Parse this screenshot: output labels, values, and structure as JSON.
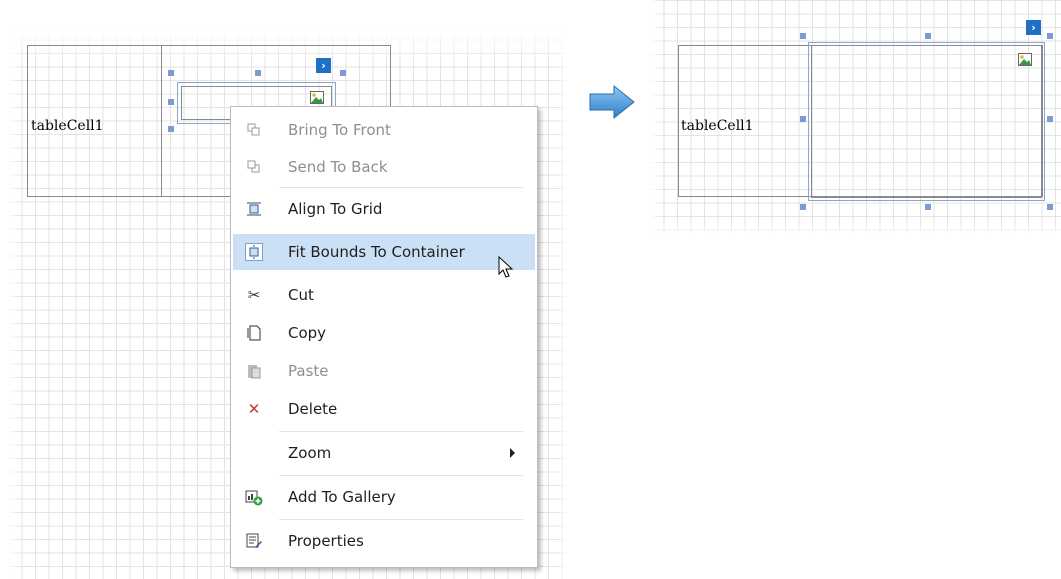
{
  "before": {
    "cell_label": "tableCell1"
  },
  "after": {
    "cell_label": "tableCell1"
  },
  "context_menu": {
    "items": [
      {
        "label": "Bring To Front",
        "icon": "bring-to-front-icon",
        "disabled": true
      },
      {
        "label": "Send To Back",
        "icon": "send-to-back-icon",
        "disabled": true
      },
      {
        "label": "Align To Grid",
        "icon": "align-to-grid-icon",
        "disabled": false
      },
      {
        "label": "Fit Bounds To Container",
        "icon": "fit-bounds-icon",
        "disabled": false,
        "highlighted": true
      },
      {
        "label": "Cut",
        "icon": "scissors-icon",
        "disabled": false
      },
      {
        "label": "Copy",
        "icon": "copy-icon",
        "disabled": false
      },
      {
        "label": "Paste",
        "icon": "paste-icon",
        "disabled": true
      },
      {
        "label": "Delete",
        "icon": "delete-icon",
        "disabled": false
      },
      {
        "label": "Zoom",
        "icon": "",
        "disabled": false,
        "submenu": true
      },
      {
        "label": "Add To Gallery",
        "icon": "add-to-gallery-icon",
        "disabled": false
      },
      {
        "label": "Properties",
        "icon": "properties-icon",
        "disabled": false
      }
    ]
  },
  "colors": {
    "highlight": "#cce0f5",
    "smart_tag": "#1f6fc4",
    "handle": "#7a9ccf",
    "delete_icon": "#c0392b",
    "arrow": "#3b8fd9"
  }
}
